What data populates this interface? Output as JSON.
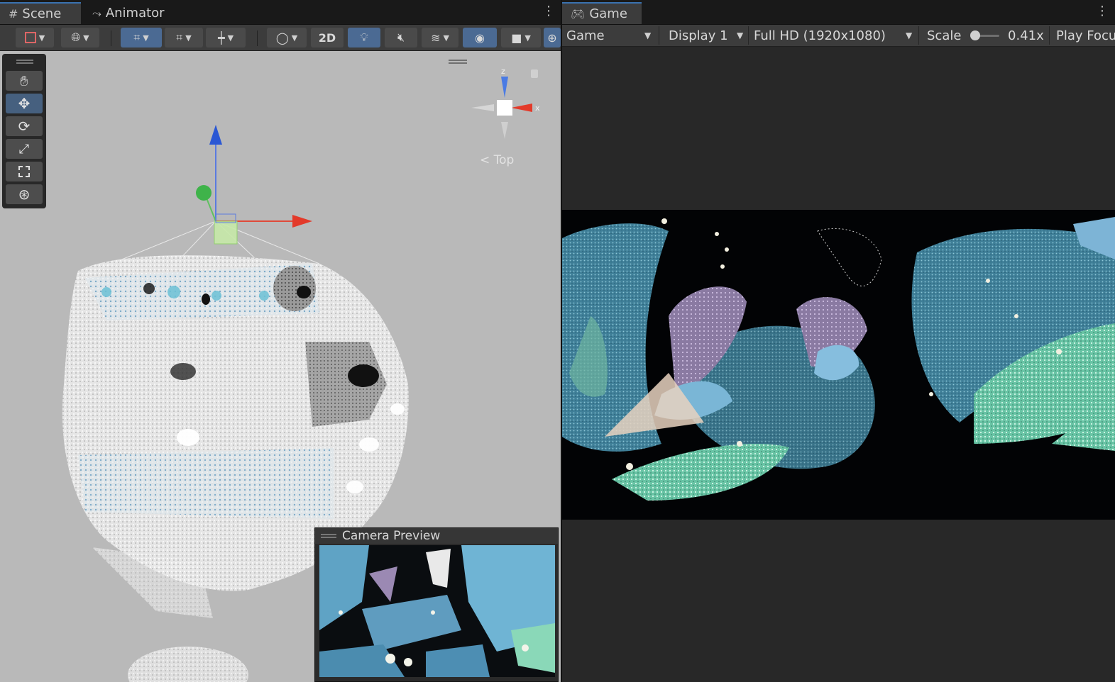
{
  "scene_panel": {
    "tabs": [
      {
        "label": "Scene",
        "icon": "hash-grid-icon"
      },
      {
        "label": "Animator",
        "icon": "animator-icon"
      }
    ],
    "toolbar": {
      "mode_2d_label": "2D"
    },
    "tools": [
      "hand-tool",
      "move-tool",
      "rotate-tool",
      "scale-tool",
      "rect-tool",
      "transform-tool"
    ],
    "active_tool": "move-tool",
    "orientation_label": "Top",
    "gizmo_axes": {
      "x": "x",
      "z": "z"
    },
    "camera_preview": {
      "title": "Camera Preview"
    }
  },
  "game_panel": {
    "tab": {
      "label": "Game",
      "icon": "gamepad-icon"
    },
    "toolbar": {
      "mode": "Game",
      "display": "Display 1",
      "resolution": "Full HD (1920x1080)",
      "scale_label": "Scale",
      "scale_value": "0.41x",
      "scale_fraction": 0.41,
      "play_focus": "Play Focu"
    }
  },
  "colors": {
    "axis_x": "#e33a2a",
    "axis_y": "#3fb34a",
    "axis_z": "#2a57d4",
    "selected": "#4b6a93",
    "viewport_bg": "#b9b9b9",
    "panel_bg": "#282828"
  }
}
